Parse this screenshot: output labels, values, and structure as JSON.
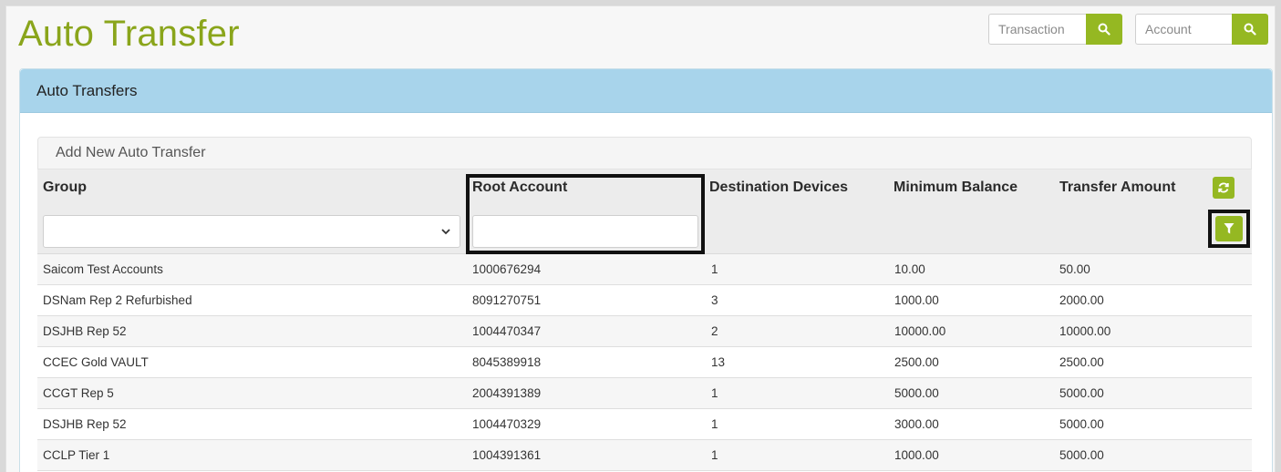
{
  "header": {
    "title": "Auto Transfer",
    "transaction_placeholder": "Transaction",
    "account_placeholder": "Account",
    "accent": "#95b822"
  },
  "panel": {
    "title": "Auto Transfers",
    "add_label": "Add New Auto Transfer"
  },
  "table": {
    "columns": [
      "Group",
      "Root Account",
      "Destination Devices",
      "Minimum Balance",
      "Transfer Amount"
    ],
    "rows": [
      [
        "Saicom Test Accounts",
        "1000676294",
        "1",
        "10.00",
        "50.00"
      ],
      [
        "DSNam Rep 2 Refurbished",
        "8091270751",
        "3",
        "1000.00",
        "2000.00"
      ],
      [
        "DSJHB Rep 52",
        "1004470347",
        "2",
        "10000.00",
        "10000.00"
      ],
      [
        "CCEC Gold VAULT",
        "8045389918",
        "13",
        "2500.00",
        "2500.00"
      ],
      [
        "CCGT Rep 5",
        "2004391389",
        "1",
        "5000.00",
        "5000.00"
      ],
      [
        "DSJHB Rep 52",
        "1004470329",
        "1",
        "3000.00",
        "5000.00"
      ],
      [
        "CCLP Tier 1",
        "1004391361",
        "1",
        "1000.00",
        "5000.00"
      ]
    ]
  },
  "icons": {
    "search": "search-icon",
    "refresh": "refresh-icon",
    "filter": "filter-icon",
    "chevron": "chevron-down-icon"
  }
}
